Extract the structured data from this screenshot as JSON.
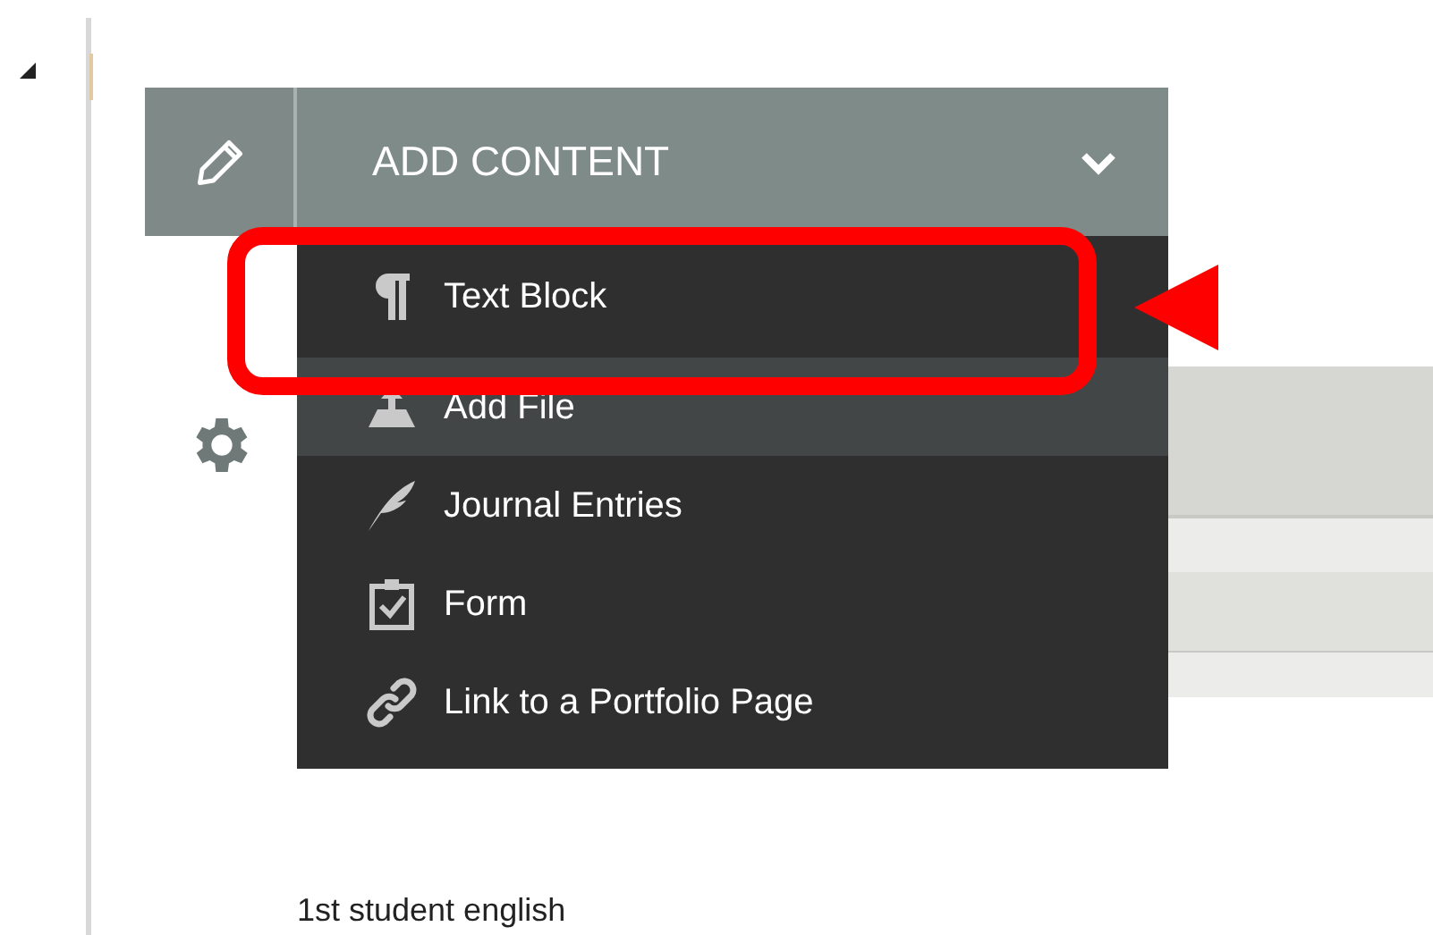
{
  "header": {
    "title": "ADD CONTENT",
    "expanded": true
  },
  "menu": [
    {
      "label": "Text Block",
      "kind": "pilcrow",
      "selected": false,
      "highlighted": true
    },
    {
      "label": "Add File",
      "kind": "upload",
      "selected": true,
      "highlighted": false
    },
    {
      "label": "Journal Entries",
      "kind": "feather",
      "selected": false,
      "highlighted": false
    },
    {
      "label": "Form",
      "kind": "clipboard",
      "selected": false,
      "highlighted": false
    },
    {
      "label": "Link to a Portfolio Page",
      "kind": "link",
      "selected": false,
      "highlighted": false
    }
  ],
  "page_text": "1st student english"
}
